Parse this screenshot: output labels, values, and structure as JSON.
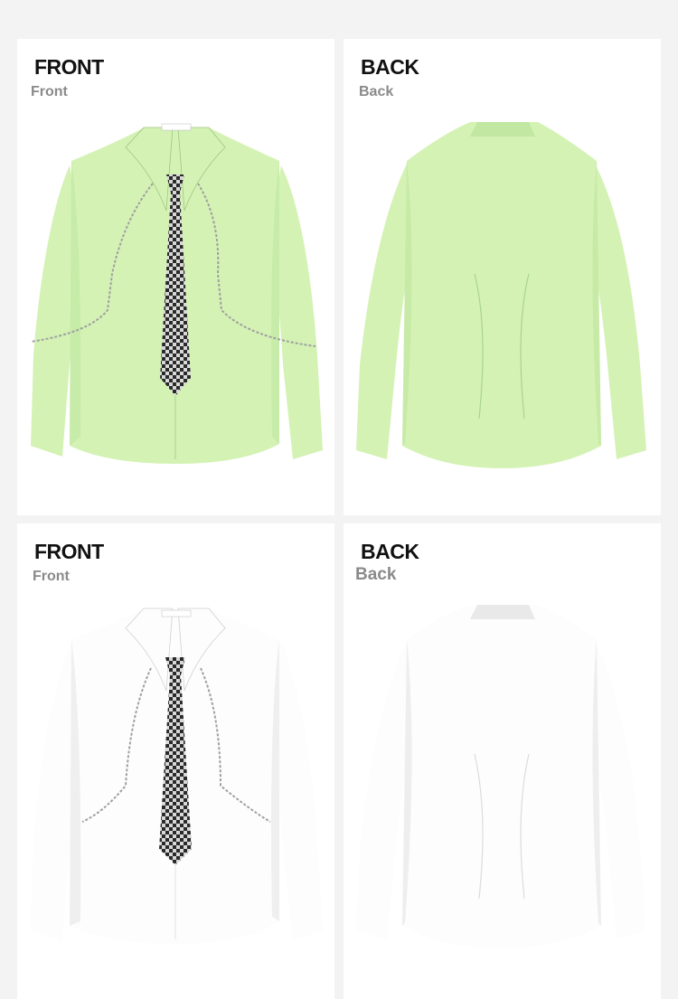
{
  "panels": [
    {
      "title": "FRONT",
      "subtitle": "Front",
      "shirt_color": "#d4f2b4",
      "shade_color": "#b9e29a",
      "view": "front"
    },
    {
      "title": "BACK",
      "subtitle": "Back",
      "shirt_color": "#d4f2b4",
      "shade_color": "#b9e29a",
      "view": "back"
    },
    {
      "title": "FRONT",
      "subtitle": "Front",
      "shirt_color": "#fdfdfd",
      "shade_color": "#e4e4e4",
      "view": "front"
    },
    {
      "title": "BACK",
      "subtitle": "Back",
      "shirt_color": "#fdfdfd",
      "shade_color": "#e4e4e4",
      "view": "back"
    }
  ],
  "tie_colors": [
    "#2a2a2a",
    "#d8d8d8"
  ],
  "chain_color": "#a0a0a0"
}
